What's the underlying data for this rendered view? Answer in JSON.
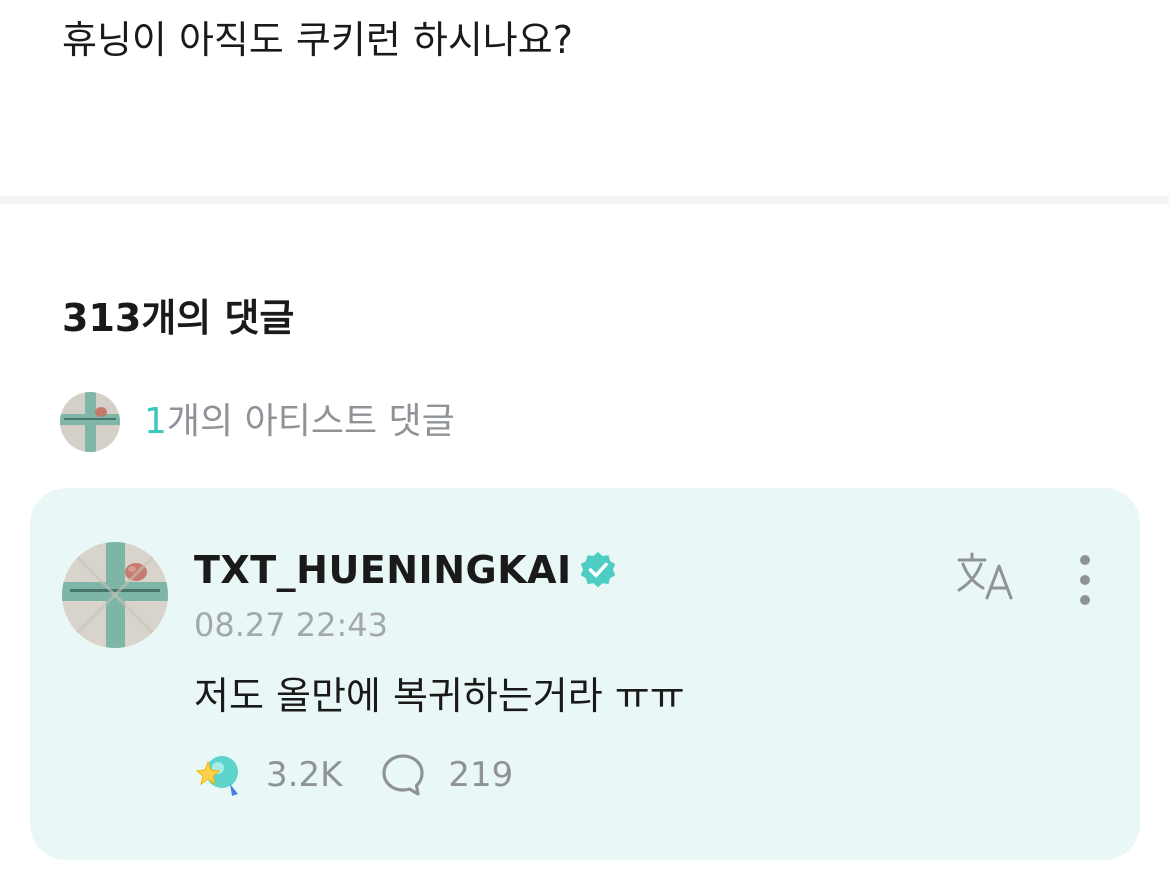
{
  "post": {
    "text": "휴닝이 아직도 쿠키런 하시나요?"
  },
  "comments_section": {
    "count_title": "313개의 댓글"
  },
  "artist_comments": {
    "count": "1",
    "label_suffix": "개의 아티스트 댓글",
    "avatar_icon": "profile-photo-cross"
  },
  "comment": {
    "author": "TXT_HUENINGKAI",
    "verified_icon": "verified-badge-icon",
    "timestamp": "08.27 22:43",
    "text": "저도 올만에 복귀하는거라 ㅠㅠ",
    "likes": "3.2K",
    "replies": "219",
    "translate_icon": "translate-icon",
    "more_icon": "more-vertical-icon",
    "like_icon": "star-cheer-icon",
    "reply_icon": "speech-bubble-icon"
  },
  "colors": {
    "accent": "#3cc9c0",
    "card_bg": "#e9f8f6",
    "muted_text": "#8f9398",
    "verified": "#4ecdc4"
  }
}
